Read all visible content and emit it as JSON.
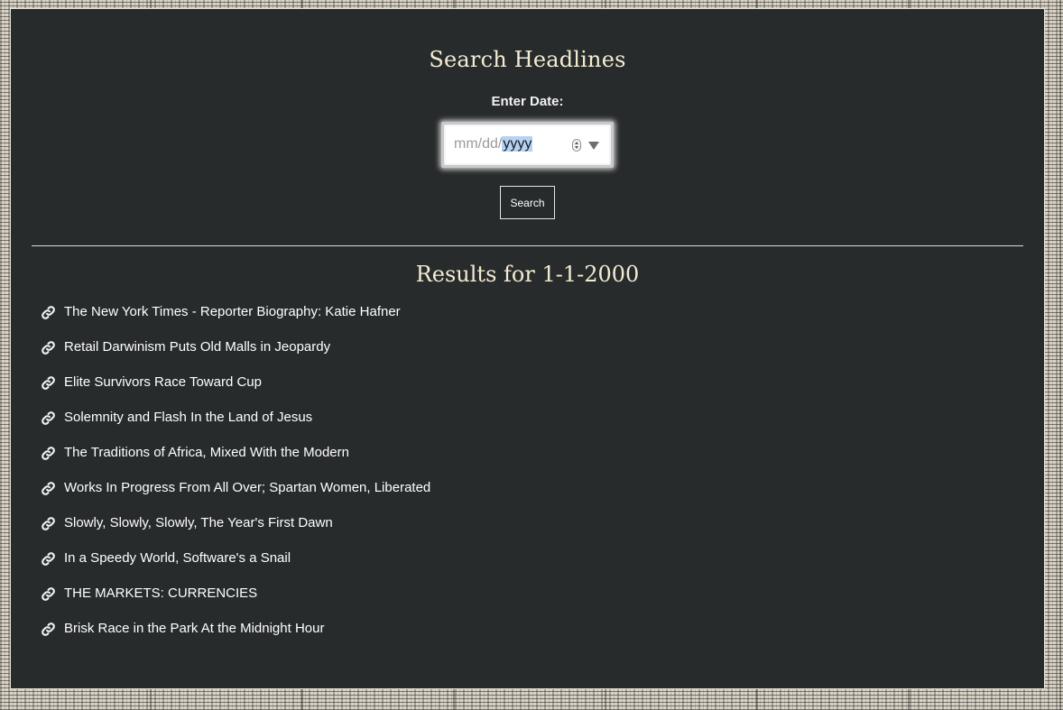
{
  "search": {
    "title": "Search Headlines",
    "date_label": "Enter Date:",
    "date_placeholder": {
      "prefix": "mm/dd/",
      "year": "yyyy"
    },
    "button_label": "Search"
  },
  "results": {
    "title": "Results for 1-1-2000",
    "items": [
      {
        "label": "The New York Times - Reporter Biography: Katie Hafner",
        "icon": "link-icon"
      },
      {
        "label": "Retail Darwinism Puts Old Malls in Jeopardy",
        "icon": "link-icon"
      },
      {
        "label": "Elite Survivors Race Toward Cup",
        "icon": "link-icon"
      },
      {
        "label": "Solemnity and Flash In the Land of Jesus",
        "icon": "link-icon"
      },
      {
        "label": "The Traditions of Africa, Mixed With the Modern",
        "icon": "link-icon"
      },
      {
        "label": "Works In Progress From All Over; Spartan Women, Liberated",
        "icon": "link-icon"
      },
      {
        "label": "Slowly, Slowly, Slowly, The Year's First Dawn",
        "icon": "link-icon"
      },
      {
        "label": "In a Speedy World, Software's a Snail",
        "icon": "link-icon"
      },
      {
        "label": "THE MARKETS: CURRENCIES",
        "icon": "link-icon"
      },
      {
        "label": "Brisk Race in the Park At the Midnight Hour",
        "icon": "link-icon"
      }
    ]
  },
  "colors": {
    "panel_background": "#272b2c",
    "heading_text": "#f4ecd2",
    "body_text": "#ffffff",
    "year_highlight": "#b5d2f5"
  }
}
